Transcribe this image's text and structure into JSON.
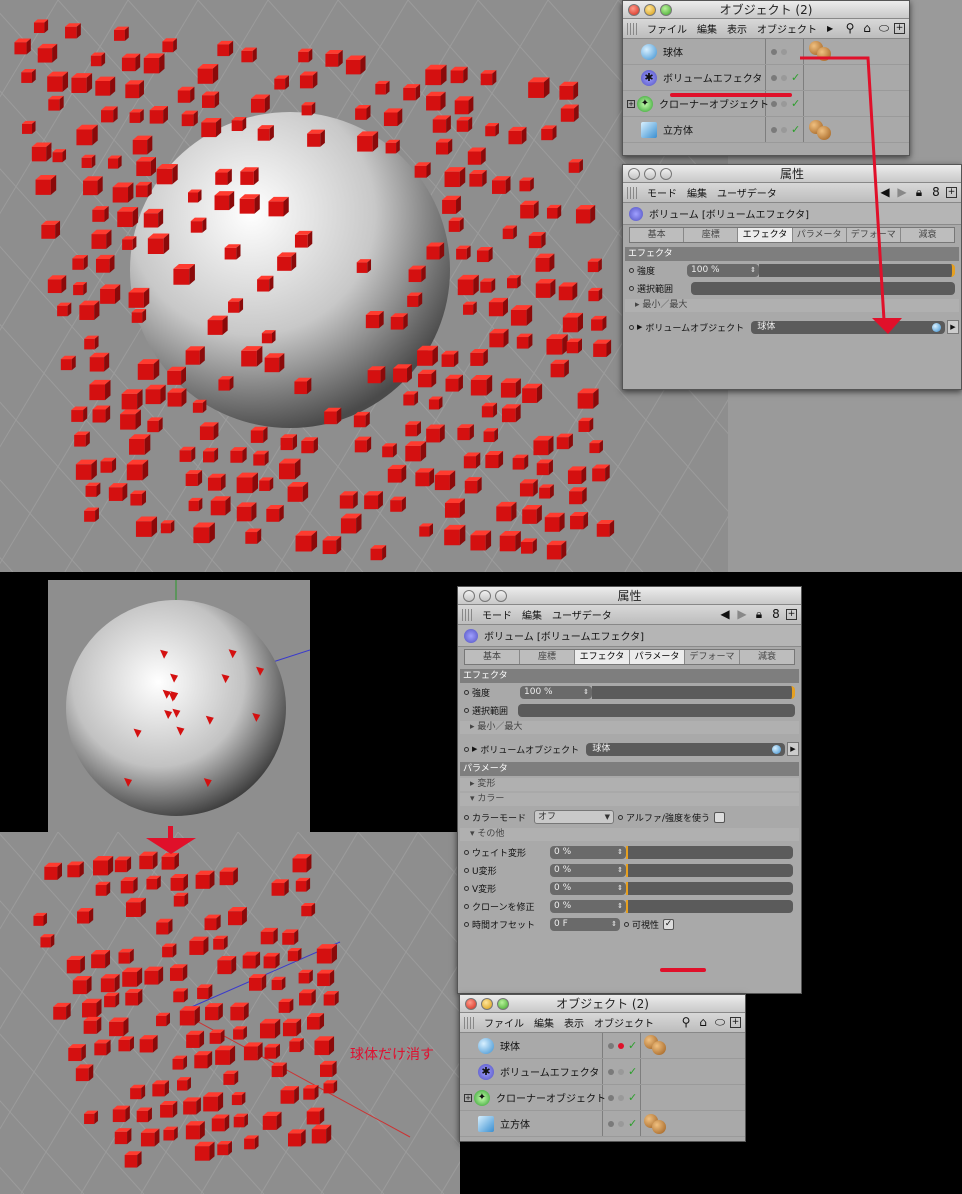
{
  "top_objects_window": {
    "title": "オブジェクト (2)",
    "menu": [
      "ファイル",
      "編集",
      "表示",
      "オブジェクト"
    ],
    "items": [
      {
        "label": "球体",
        "icon": "sphere-icon",
        "material": true
      },
      {
        "label": "ボリュームエフェクタ",
        "icon": "volume-effector-icon",
        "material": false
      },
      {
        "label": "クローナーオブジェクト",
        "icon": "cloner-icon",
        "material": false
      },
      {
        "label": "立方体",
        "icon": "cube-icon",
        "material": true
      }
    ]
  },
  "top_attr_window": {
    "title": "属性",
    "menu": [
      "モード",
      "編集",
      "ユーザデータ"
    ],
    "object_name": "ボリューム [ボリュームエフェクタ]",
    "tabs": [
      "基本",
      "座標",
      "エフェクタ",
      "パラメータ",
      "デフォーマ",
      "減衰"
    ],
    "active_tab": "エフェクタ",
    "section": "エフェクタ",
    "strength_label": "強度",
    "strength_value": "100 %",
    "selection_label": "選択範囲",
    "minmax_label": "最小／最大",
    "volume_object_label": "ボリュームオブジェクト",
    "volume_object_value": "球体"
  },
  "bottom_attr_window": {
    "title": "属性",
    "menu": [
      "モード",
      "編集",
      "ユーザデータ"
    ],
    "object_name": "ボリューム [ボリュームエフェクタ]",
    "tabs": [
      "基本",
      "座標",
      "エフェクタ",
      "パラメータ",
      "デフォーマ",
      "減衰"
    ],
    "active_tabs": [
      "エフェクタ",
      "パラメータ"
    ],
    "section_effector": "エフェクタ",
    "strength_label": "強度",
    "strength_value": "100 %",
    "selection_label": "選択範囲",
    "minmax_label": "最小／最大",
    "volume_object_label": "ボリュームオブジェクト",
    "volume_object_value": "球体",
    "section_params": "パラメータ",
    "sub_transform": "変形",
    "sub_color": "カラー",
    "color_mode_label": "カラーモード",
    "color_mode_value": "オフ",
    "alpha_label": "アルファ/強度を使う",
    "sub_other": "その他",
    "weight_label": "ウェイト変形",
    "weight_value": "0 %",
    "u_label": "U変形",
    "u_value": "0 %",
    "v_label": "V変形",
    "v_value": "0 %",
    "clone_label": "クローンを修正",
    "clone_value": "0 %",
    "time_label": "時間オフセット",
    "time_value": "0 F",
    "visible_label": "可視性"
  },
  "bottom_objects_window": {
    "title": "オブジェクト (2)",
    "menu": [
      "ファイル",
      "編集",
      "表示",
      "オブジェクト"
    ],
    "items": [
      {
        "label": "球体",
        "icon": "sphere-icon",
        "material": true
      },
      {
        "label": "ボリュームエフェクタ",
        "icon": "volume-effector-icon",
        "material": false
      },
      {
        "label": "クローナーオブジェクト",
        "icon": "cloner-icon",
        "material": false
      },
      {
        "label": "立方体",
        "icon": "cube-icon",
        "material": true
      }
    ]
  },
  "annotation_text": "球体だけ消す",
  "colors": {
    "accent_red": "#e0102a",
    "cube_red": "#d41010",
    "panel_gray": "#a9a9a9"
  }
}
